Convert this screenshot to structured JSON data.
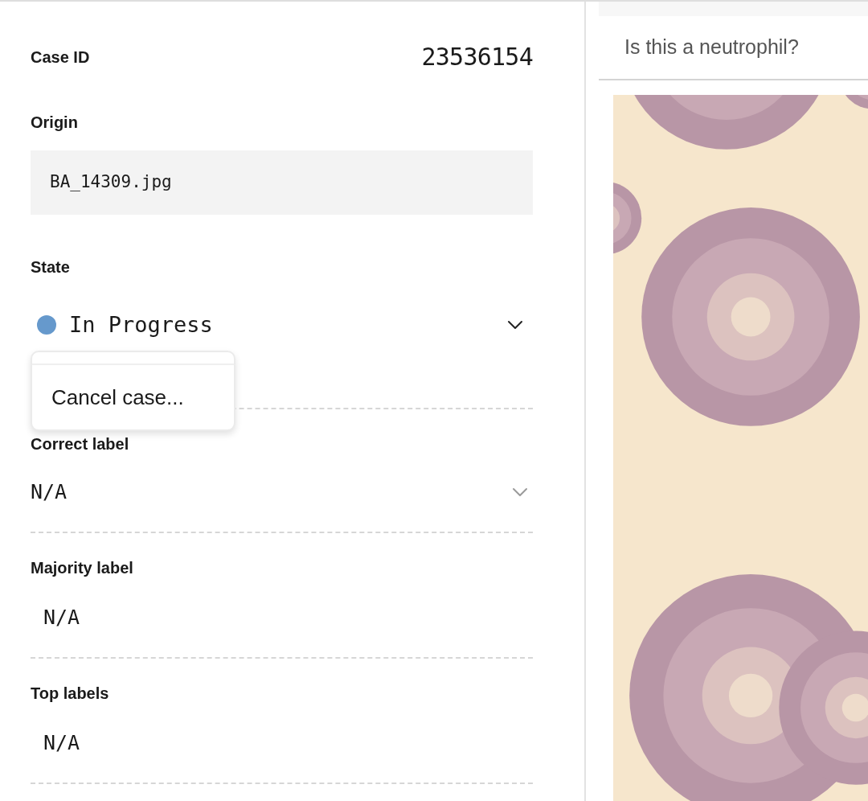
{
  "case_id": {
    "label": "Case ID",
    "value": "23536154"
  },
  "origin": {
    "label": "Origin",
    "value": "BA_14309.jpg"
  },
  "state": {
    "label": "State",
    "value": "In Progress",
    "color": "#6699cc",
    "expanded": true,
    "menu": [
      "Cancel case..."
    ]
  },
  "fields": [
    {
      "label": "Correct label",
      "value": "N/A",
      "kind": "select"
    },
    {
      "label": "Majority label",
      "value": "N/A",
      "kind": "text"
    },
    {
      "label": "Top labels",
      "value": "N/A",
      "kind": "text"
    }
  ],
  "question": "Is this a neutrophil?"
}
